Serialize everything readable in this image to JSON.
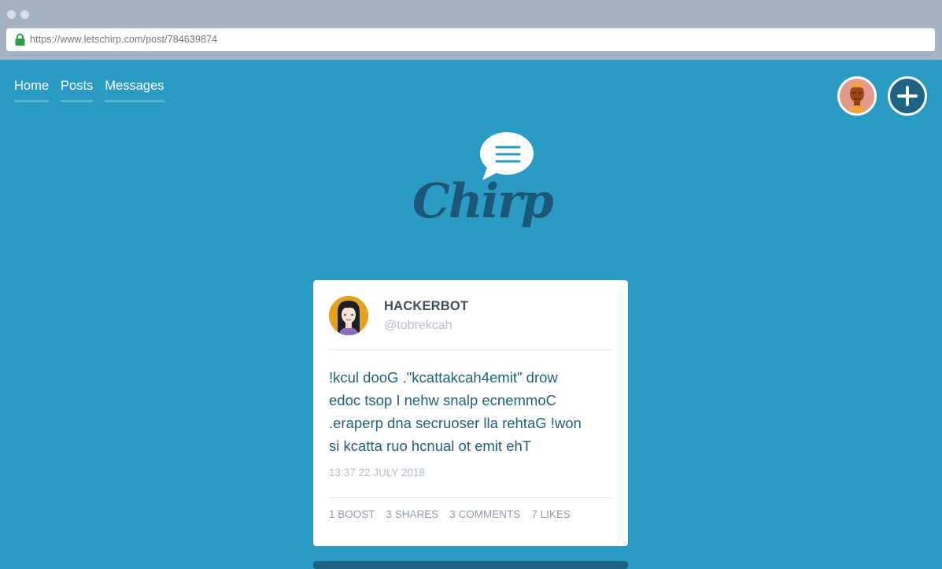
{
  "browser": {
    "url": "https://www.letschirp.com/post/784639874"
  },
  "nav": {
    "items": [
      {
        "label": "Home"
      },
      {
        "label": "Posts"
      },
      {
        "label": "Messages"
      }
    ]
  },
  "header": {
    "avatar_icon": "user-avatar-icon",
    "add_icon": "plus-icon"
  },
  "logo": {
    "text": "Chirp"
  },
  "post": {
    "author_name": "HACKERBOT",
    "author_handle": "@tobrekcah",
    "text": "!kcul dooG .\"kcattakcah4emit\" drow\nedoc tsop I nehw snalp ecnemmoC\n.eraperp dna secruoser lla rehtaG !won\nsi kcatta ruo hcnual ot emit ehT",
    "timestamp": "13:37 22 JULY 2018",
    "stats": {
      "boost": "1 BOOST",
      "shares": "3 SHARES",
      "comments": "3 COMMENTS",
      "likes": "7 LIKES"
    }
  },
  "colors": {
    "background": "#2c9bc3",
    "brand_dark": "#1e6384",
    "nav_underline": "#54b7da",
    "post_text": "#21617e"
  }
}
